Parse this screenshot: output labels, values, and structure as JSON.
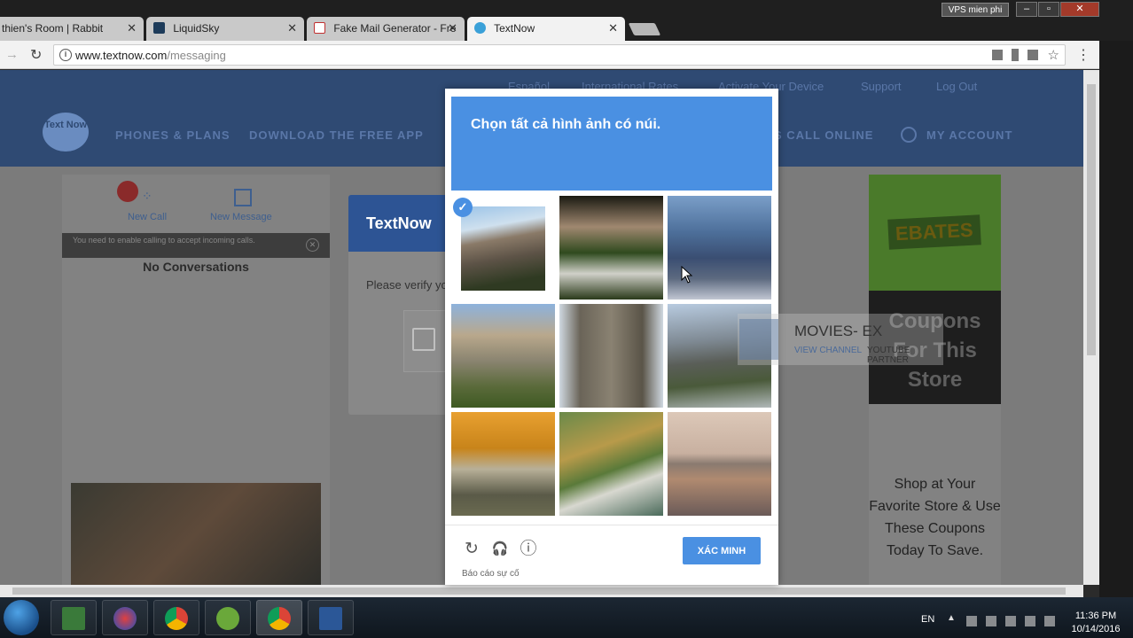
{
  "browser": {
    "tabs": [
      {
        "title": "thien's Room | Rabbit",
        "active": false
      },
      {
        "title": "LiquidSky",
        "active": false
      },
      {
        "title": "Fake Mail Generator - Fre",
        "active": false
      },
      {
        "title": "TextNow",
        "active": true
      }
    ],
    "close_glyph": "✕",
    "vps_label": "VPS mien phi",
    "url_host": "www.textnow.com",
    "url_path": "/messaging"
  },
  "site": {
    "top_links": [
      "Español",
      "International Rates",
      "Activate Your Device",
      "Support",
      "Log Out"
    ],
    "nav": [
      "PHONES & PLANS",
      "DOWNLOAD THE FREE APP",
      "S CALL ONLINE",
      "MY ACCOUNT"
    ],
    "logo_text": "Text Now",
    "left_panel": {
      "new_call": "New Call",
      "new_message": "New Message",
      "call_notice": "You need to enable calling to accept incoming calls.",
      "no_conversations": "No Conversations"
    },
    "dialog": {
      "title": "TextNow",
      "text": "Please verify yo"
    },
    "ad": {
      "brand": "EBATES",
      "headline": "Coupons For This Store",
      "body": "Shop at Your Favorite Store & Use These Coupons Today To Save."
    }
  },
  "captcha": {
    "instruction": "Chọn tất cả hình ảnh có núi.",
    "tiles": [
      {
        "name": "mountain-peak",
        "selected": true
      },
      {
        "name": "garden-path",
        "selected": false
      },
      {
        "name": "valley-view",
        "selected": false
      },
      {
        "name": "hillside-town",
        "selected": false
      },
      {
        "name": "stone-tower",
        "selected": false
      },
      {
        "name": "mountain-valley",
        "selected": false
      },
      {
        "name": "autumn-bridge",
        "selected": false
      },
      {
        "name": "river-mill",
        "selected": false
      },
      {
        "name": "city-waterfront",
        "selected": false
      }
    ],
    "check_glyph": "✓",
    "icons": {
      "reload": "↻",
      "audio": "🎧",
      "info": "ⓘ"
    },
    "verify_label": "XÁC MINH",
    "report_label": "Báo cáo sự cố"
  },
  "watermark": {
    "title": "MOVIES- EX",
    "sub1": "VIEW CHANNEL",
    "sub2": "YOUTUBE PARTNER"
  },
  "taskbar": {
    "language": "EN",
    "time": "11:36 PM",
    "date": "10/14/2016"
  }
}
